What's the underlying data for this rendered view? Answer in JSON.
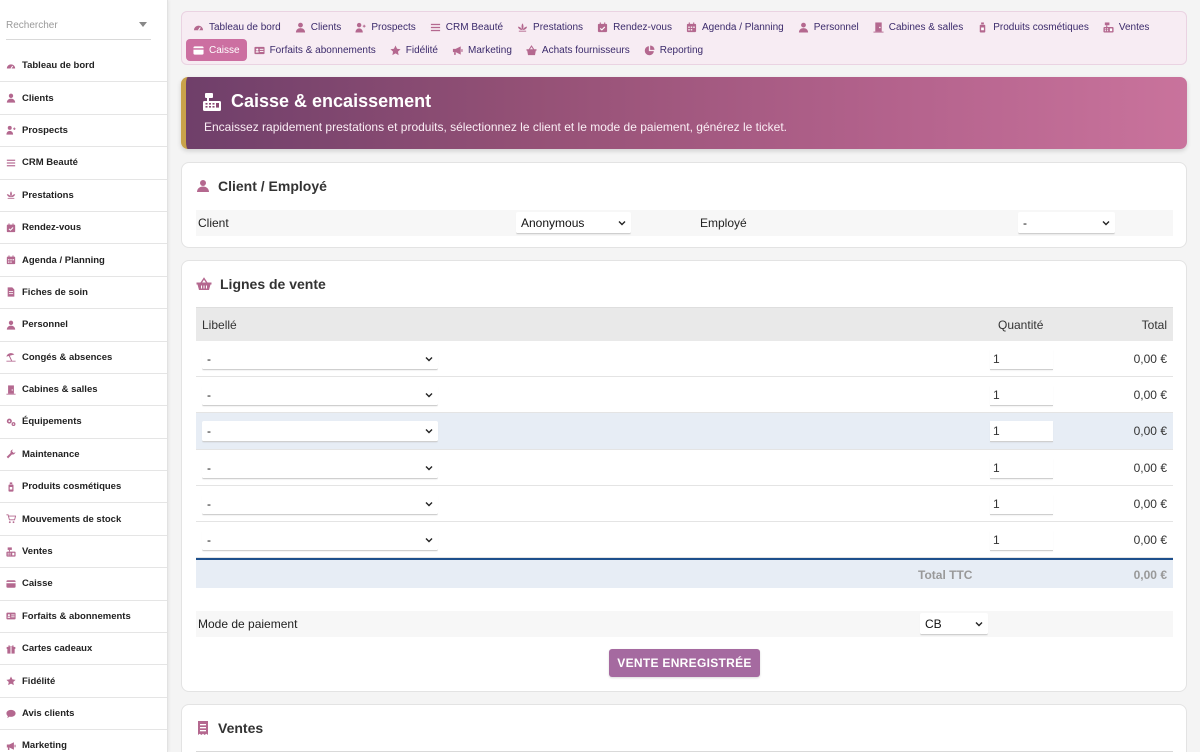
{
  "search": {
    "placeholder": "Rechercher"
  },
  "sidebar": {
    "items": [
      {
        "label": "Tableau de bord",
        "icon": "dashboard-icon"
      },
      {
        "label": "Clients",
        "icon": "user-icon"
      },
      {
        "label": "Prospects",
        "icon": "user-plus-icon"
      },
      {
        "label": "CRM Beauté",
        "icon": "list-icon"
      },
      {
        "label": "Prestations",
        "icon": "lotus-icon"
      },
      {
        "label": "Rendez-vous",
        "icon": "calendar-check-icon"
      },
      {
        "label": "Agenda / Planning",
        "icon": "calendar-icon"
      },
      {
        "label": "Fiches de soin",
        "icon": "file-icon"
      },
      {
        "label": "Personnel",
        "icon": "user-icon"
      },
      {
        "label": "Congés & absences",
        "icon": "umbrella-beach-icon"
      },
      {
        "label": "Cabines & salles",
        "icon": "door-icon"
      },
      {
        "label": "Équipements",
        "icon": "gears-icon"
      },
      {
        "label": "Maintenance",
        "icon": "wrench-icon"
      },
      {
        "label": "Produits cosmétiques",
        "icon": "bottle-icon"
      },
      {
        "label": "Mouvements de stock",
        "icon": "cart-icon"
      },
      {
        "label": "Ventes",
        "icon": "cash-register-icon"
      },
      {
        "label": "Caisse",
        "icon": "cash-icon"
      },
      {
        "label": "Forfaits & abonnements",
        "icon": "id-card-icon"
      },
      {
        "label": "Cartes cadeaux",
        "icon": "gift-icon"
      },
      {
        "label": "Fidélité",
        "icon": "star-icon"
      },
      {
        "label": "Avis clients",
        "icon": "comment-icon"
      },
      {
        "label": "Marketing",
        "icon": "bullhorn-icon"
      }
    ]
  },
  "topnav": {
    "row1": [
      {
        "label": "Tableau de bord",
        "icon": "dashboard-icon"
      },
      {
        "label": "Clients",
        "icon": "user-icon"
      },
      {
        "label": "Prospects",
        "icon": "user-plus-icon"
      },
      {
        "label": "CRM Beauté",
        "icon": "list-icon"
      },
      {
        "label": "Prestations",
        "icon": "lotus-icon"
      },
      {
        "label": "Rendez-vous",
        "icon": "calendar-check-icon"
      },
      {
        "label": "Agenda / Planning",
        "icon": "calendar-icon"
      },
      {
        "label": "Personnel",
        "icon": "user-icon"
      },
      {
        "label": "Cabines & salles",
        "icon": "door-icon"
      },
      {
        "label": "Produits cosmétiques",
        "icon": "bottle-icon"
      },
      {
        "label": "Ventes",
        "icon": "cash-register-icon"
      }
    ],
    "row2": [
      {
        "label": "Caisse",
        "icon": "cash-icon",
        "active": true
      },
      {
        "label": "Forfaits & abonnements",
        "icon": "id-card-icon"
      },
      {
        "label": "Fidélité",
        "icon": "star-icon"
      },
      {
        "label": "Marketing",
        "icon": "bullhorn-icon"
      },
      {
        "label": "Achats fournisseurs",
        "icon": "basket-icon"
      },
      {
        "label": "Reporting",
        "icon": "pie-chart-icon"
      }
    ]
  },
  "banner": {
    "title": "Caisse & encaissement",
    "subtitle": "Encaissez rapidement prestations et produits, sélectionnez le client et le mode de paiement, générez le ticket."
  },
  "client_section": {
    "title": "Client / Employé",
    "client_label": "Client",
    "client_value": "Anonymous",
    "employee_label": "Employé",
    "employee_value": "-"
  },
  "sales_lines": {
    "title": "Lignes de vente",
    "headers": {
      "label": "Libellé",
      "quantity": "Quantité",
      "total": "Total"
    },
    "rows": [
      {
        "item": "-",
        "quantity": "1",
        "total": "0,00 €"
      },
      {
        "item": "-",
        "quantity": "1",
        "total": "0,00 €"
      },
      {
        "item": "-",
        "quantity": "1",
        "total": "0,00 €"
      },
      {
        "item": "-",
        "quantity": "1",
        "total": "0,00 €"
      },
      {
        "item": "-",
        "quantity": "1",
        "total": "0,00 €"
      },
      {
        "item": "-",
        "quantity": "1",
        "total": "0,00 €"
      }
    ],
    "highlighted_row": 2,
    "total_label": "Total TTC",
    "total_value": "0,00 €",
    "payment_label": "Mode de paiement",
    "payment_value": "CB",
    "save_button": "VENTE ENREGISTRÉE"
  },
  "sales_section": {
    "title": "Ventes"
  },
  "colors": {
    "accent": "#cc6fa1",
    "banner_start": "#6f3f6a",
    "banner_end": "#c9739c",
    "button": "#a56aa0",
    "nav_bg": "#f7ecf3",
    "icon": "#b4688f"
  }
}
